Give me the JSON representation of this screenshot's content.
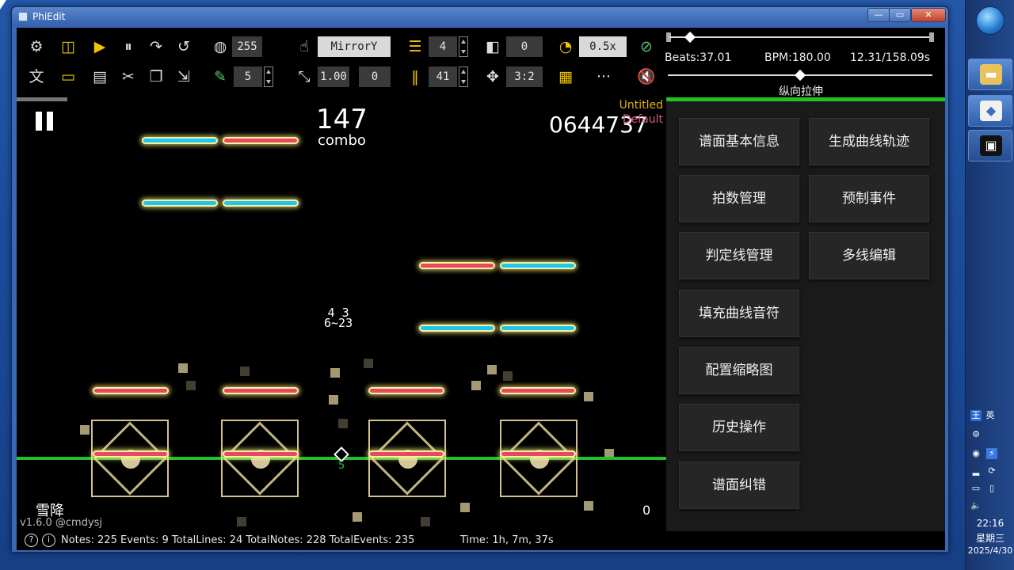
{
  "window": {
    "title": "PhiEdit",
    "min": "—",
    "max": "▭",
    "close": "✕"
  },
  "toolbar": {
    "alpha_value": "255",
    "mirror_value": "MirrorY",
    "lines_value": "4",
    "offset_value": "0",
    "speed_value": "0.5x",
    "edit_value": "5",
    "scale_value": "1.00",
    "scale_offset": "0",
    "grid_value": "41",
    "ratio_value": "3:2",
    "more": "···"
  },
  "timeline": {
    "beats": "Beats:37.01",
    "bpm": "BPM:180.00",
    "time": "12.31/158.09s",
    "stretch_label": "纵向拉伸",
    "progress": 0.078,
    "stretch": 0.5
  },
  "preview": {
    "combo": "147",
    "combo_label": "combo",
    "score": "0644737",
    "chart_name": "Untitled",
    "difficulty": "Default",
    "song": "雪降",
    "version": "v1.6.0 @cmdysj",
    "right_value": "0",
    "note_label_top": "4  3",
    "note_label_bottom": "6~23",
    "line_label": "5"
  },
  "panel": {
    "buttons": [
      "谱面基本信息",
      "生成曲线轨迹",
      "拍数管理",
      "预制事件",
      "判定线管理",
      "多线编辑",
      "填充曲线音符",
      "配置缩略图",
      "历史操作",
      "谱面纠错"
    ]
  },
  "status": {
    "text": "Notes: 225 Events: 9 TotalLines: 24 TotalNotes: 228 TotalEvents: 235",
    "time": "Time: 1h, 7m, 37s"
  },
  "taskbar": {
    "ime_1": "王",
    "ime_2": "英",
    "time": "22:16",
    "weekday": "星期三",
    "date": "2025/4/30"
  },
  "colors": {
    "accent_green": "#1ec61e",
    "note_blue": "#1ec7f0",
    "note_red": "#e84864",
    "icon_yellow": "#f0c400"
  }
}
